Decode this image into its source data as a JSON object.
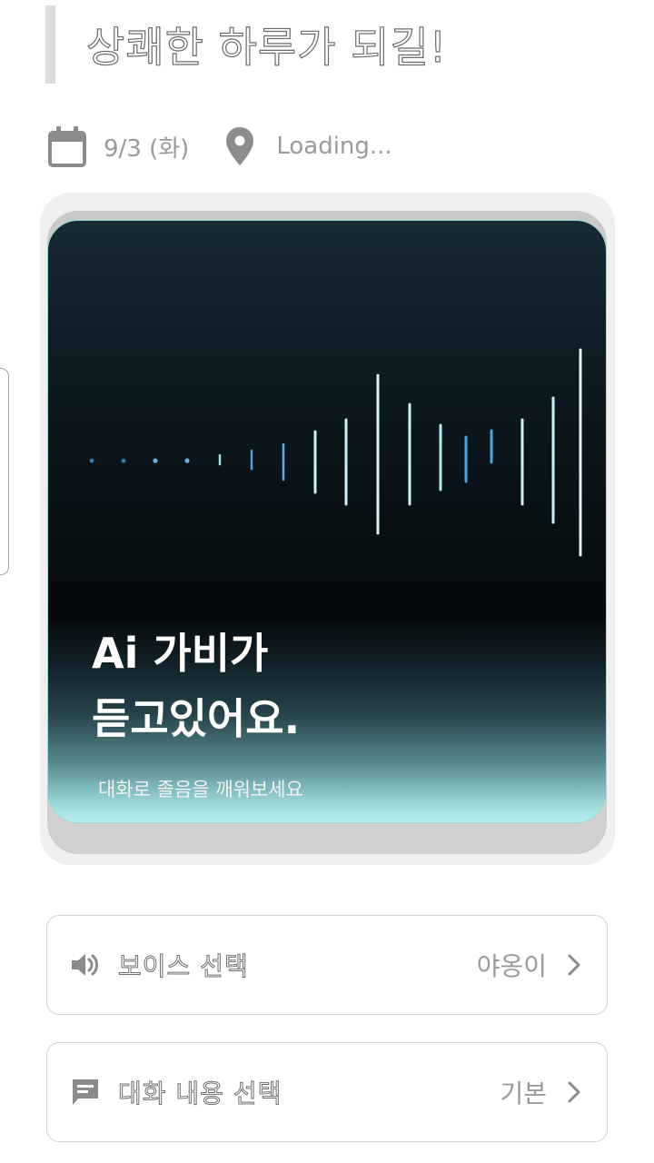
{
  "header": {
    "greeting": "상쾌한 하루가 되길!"
  },
  "meta": {
    "date": "9/3 (화)",
    "location": "Loading...",
    "date_icon": "calendar-icon",
    "location_icon": "location-pin-icon"
  },
  "hero": {
    "title_line1": "Ai 가비가",
    "title_line2": "듣고있어요.",
    "subtitle": "대화로 졸음을 깨워보세요",
    "icon": "sound-wave-visualizer"
  },
  "options": {
    "voice": {
      "label": "보이스 선택",
      "value": "야옹이",
      "icon": "speaker-icon"
    },
    "conversation": {
      "label": "대화 내용 선택",
      "value": "기본",
      "icon": "chat-icon"
    }
  },
  "colors": {
    "accent_cyan": "#b6efee",
    "wave_light": "#cdeff8",
    "wave_blue": "#4ea3dc",
    "muted_text": "#9a9a9a"
  }
}
